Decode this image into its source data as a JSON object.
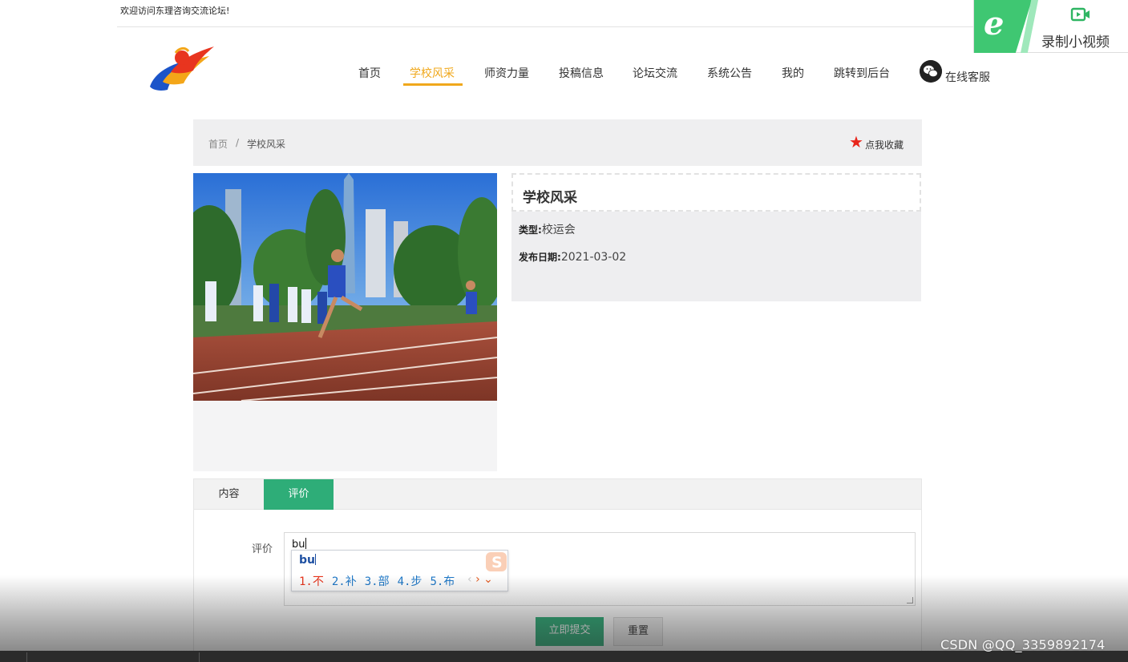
{
  "welcome_text": "欢迎访问东理咨询交流论坛!",
  "recorder": {
    "label": "录制小视频",
    "icon": "video-camera-icon"
  },
  "nav": {
    "items": [
      "首页",
      "学校风采",
      "师资力量",
      "投稿信息",
      "论坛交流",
      "系统公告",
      "我的",
      "跳转到后台"
    ],
    "active": "学校风采",
    "customer_service": "在线客服",
    "customer_service_icon": "wechat-icon"
  },
  "breadcrumb": {
    "home": "首页",
    "separator": "/",
    "current": "学校风采"
  },
  "favorite": {
    "label": "点我收藏",
    "icon": "star-icon",
    "color": "#e8251b"
  },
  "detail": {
    "title": "学校风采",
    "type_label": "类型:",
    "type_value": "校运会",
    "date_label": "发布日期:",
    "date_value": "2021-03-02"
  },
  "tabs": [
    {
      "label": "内容",
      "active": false
    },
    {
      "label": "评价",
      "active": true
    }
  ],
  "review_form": {
    "label": "评价",
    "value": "bu",
    "submit_label": "立即提交",
    "reset_label": "重置"
  },
  "ime": {
    "input": "bu",
    "candidates": [
      "1.不",
      "2.补",
      "3.部",
      "4.步",
      "5.布"
    ],
    "prev_symbol": "‹",
    "next_symbol": "›",
    "expand_symbol": "⌄"
  },
  "watermark": "CSDN @QQ_3359892174",
  "colors": {
    "accent": "#2ead78",
    "nav_active": "#f0a81c"
  }
}
